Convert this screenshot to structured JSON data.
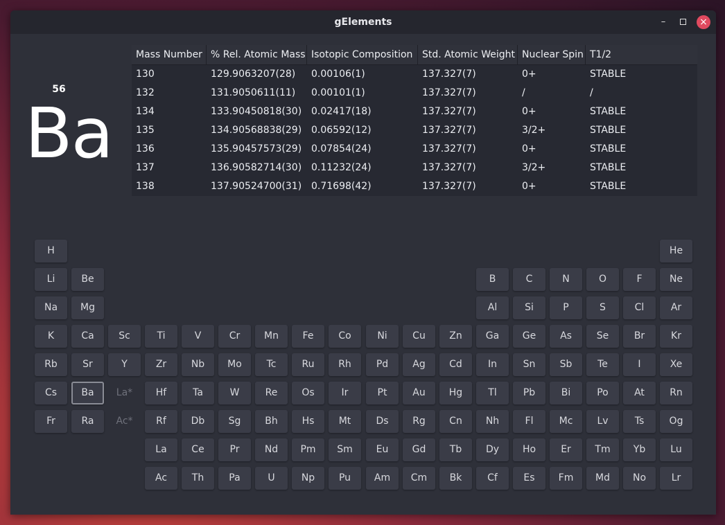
{
  "window": {
    "title": "gElements"
  },
  "element": {
    "atomic_number": "56",
    "symbol": "Ba"
  },
  "isotope_table": {
    "headers": [
      "Mass Number",
      "% Rel. Atomic Mass",
      "Isotopic Composition",
      "Std. Atomic Weight",
      "Nuclear Spin",
      "T1/2"
    ],
    "rows": [
      [
        "130",
        "129.9063207(28)",
        "0.00106(1)",
        "137.327(7)",
        "0+",
        "STABLE"
      ],
      [
        "132",
        "131.9050611(11)",
        "0.00101(1)",
        "137.327(7)",
        "/",
        "/"
      ],
      [
        "134",
        "133.90450818(30)",
        "0.02417(18)",
        "137.327(7)",
        "0+",
        "STABLE"
      ],
      [
        "135",
        "134.90568838(29)",
        "0.06592(12)",
        "137.327(7)",
        "3/2+",
        "STABLE"
      ],
      [
        "136",
        "135.90457573(29)",
        "0.07854(24)",
        "137.327(7)",
        "0+",
        "STABLE"
      ],
      [
        "137",
        "136.90582714(30)",
        "0.11232(24)",
        "137.327(7)",
        "3/2+",
        "STABLE"
      ],
      [
        "138",
        "137.90524700(31)",
        "0.71698(42)",
        "137.327(7)",
        "0+",
        "STABLE"
      ]
    ]
  },
  "periodic_table": {
    "selected": "Ba",
    "rows": [
      [
        "H",
        "",
        "",
        "",
        "",
        "",
        "",
        "",
        "",
        "",
        "",
        "",
        "",
        "",
        "",
        "",
        "",
        "He"
      ],
      [
        "Li",
        "Be",
        "",
        "",
        "",
        "",
        "",
        "",
        "",
        "",
        "",
        "",
        "B",
        "C",
        "N",
        "O",
        "F",
        "Ne"
      ],
      [
        "Na",
        "Mg",
        "",
        "",
        "",
        "",
        "",
        "",
        "",
        "",
        "",
        "",
        "Al",
        "Si",
        "P",
        "S",
        "Cl",
        "Ar"
      ],
      [
        "K",
        "Ca",
        "Sc",
        "Ti",
        "V",
        "Cr",
        "Mn",
        "Fe",
        "Co",
        "Ni",
        "Cu",
        "Zn",
        "Ga",
        "Ge",
        "As",
        "Se",
        "Br",
        "Kr"
      ],
      [
        "Rb",
        "Sr",
        "Y",
        "Zr",
        "Nb",
        "Mo",
        "Tc",
        "Ru",
        "Rh",
        "Pd",
        "Ag",
        "Cd",
        "In",
        "Sn",
        "Sb",
        "Te",
        "I",
        "Xe"
      ],
      [
        "Cs",
        "Ba",
        "La*",
        "Hf",
        "Ta",
        "W",
        "Re",
        "Os",
        "Ir",
        "Pt",
        "Au",
        "Hg",
        "Tl",
        "Pb",
        "Bi",
        "Po",
        "At",
        "Rn"
      ],
      [
        "Fr",
        "Ra",
        "Ac*",
        "Rf",
        "Db",
        "Sg",
        "Bh",
        "Hs",
        "Mt",
        "Ds",
        "Rg",
        "Cn",
        "Nh",
        "Fl",
        "Mc",
        "Lv",
        "Ts",
        "Og"
      ],
      [
        "",
        "",
        "",
        "La",
        "Ce",
        "Pr",
        "Nd",
        "Pm",
        "Sm",
        "Eu",
        "Gd",
        "Tb",
        "Dy",
        "Ho",
        "Er",
        "Tm",
        "Yb",
        "Lu"
      ],
      [
        "",
        "",
        "",
        "Ac",
        "Th",
        "Pa",
        "U",
        "Np",
        "Pu",
        "Am",
        "Cm",
        "Bk",
        "Cf",
        "Es",
        "Fm",
        "Md",
        "No",
        "Lr"
      ]
    ],
    "placeholders": [
      "La*",
      "Ac*"
    ]
  }
}
